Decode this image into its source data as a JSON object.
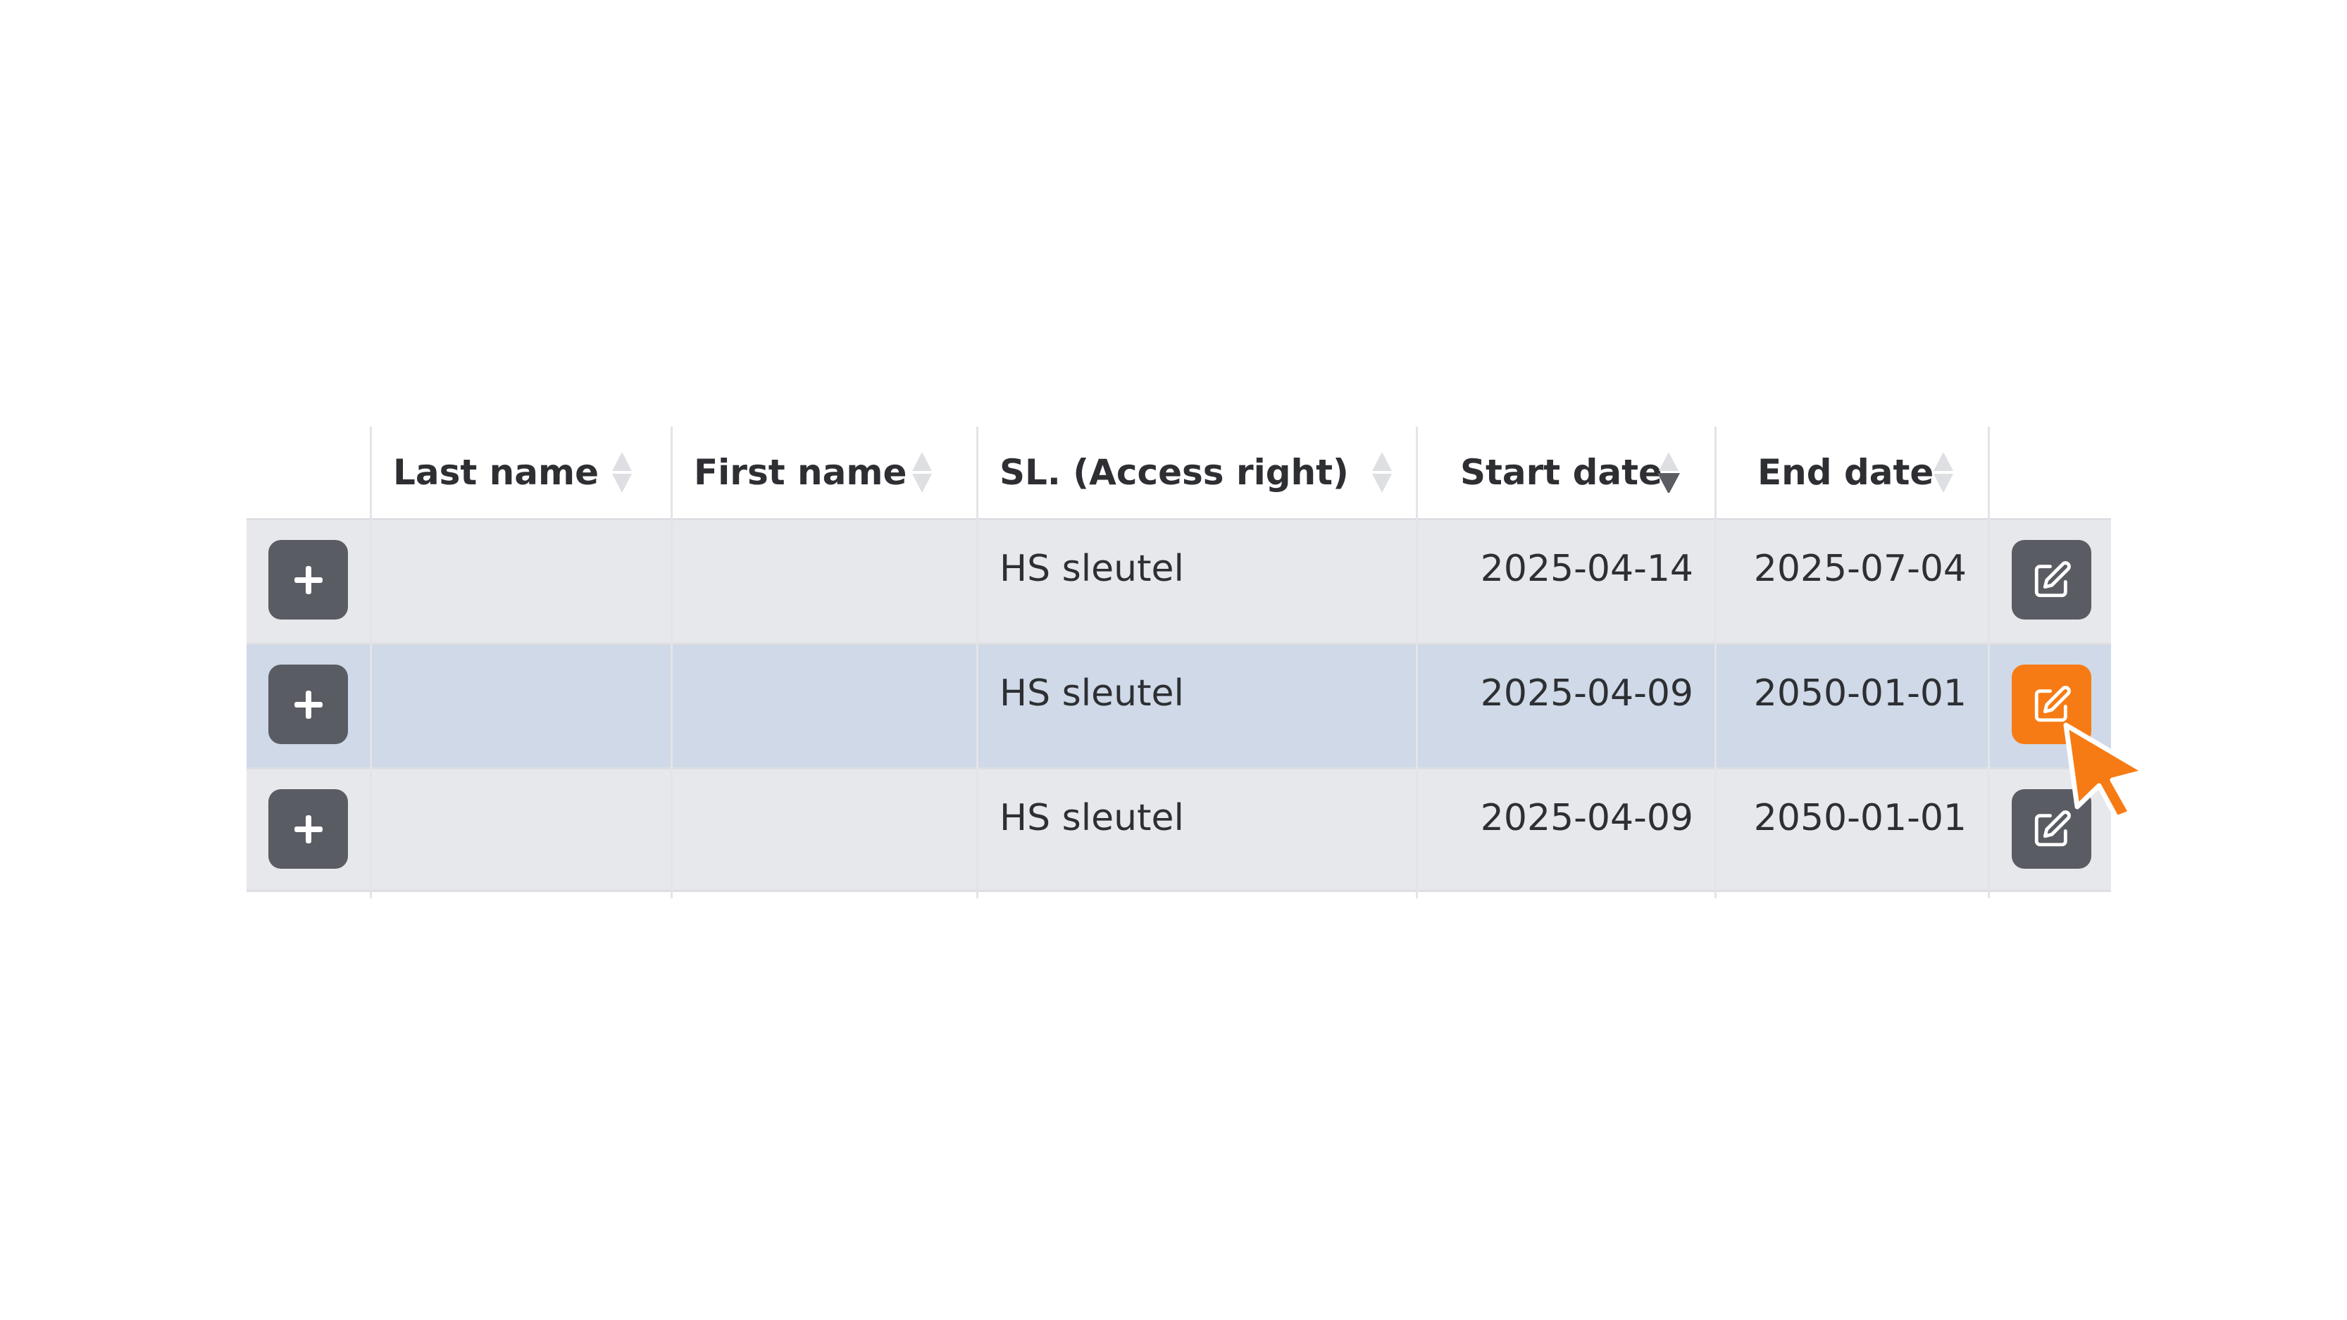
{
  "table": {
    "columns": [
      {
        "key": "actions_left",
        "label": ""
      },
      {
        "key": "last_name",
        "label": "Last name",
        "sort": "none"
      },
      {
        "key": "first_name",
        "label": "First name",
        "sort": "none"
      },
      {
        "key": "access_right",
        "label": "SL. (Access right)",
        "sort": "none"
      },
      {
        "key": "start_date",
        "label": "Start date",
        "sort": "descending"
      },
      {
        "key": "end_date",
        "label": "End date",
        "sort": "none"
      },
      {
        "key": "actions_right",
        "label": ""
      }
    ],
    "rows": [
      {
        "last_name": "",
        "first_name": "",
        "access_right": "HS sleutel",
        "start_date": "2025-04-14",
        "end_date": "2025-07-04",
        "selected": false
      },
      {
        "last_name": "",
        "first_name": "",
        "access_right": "HS sleutel",
        "start_date": "2025-04-09",
        "end_date": "2050-01-01",
        "selected": true
      },
      {
        "last_name": "",
        "first_name": "",
        "access_right": "HS sleutel",
        "start_date": "2025-04-09",
        "end_date": "2050-01-01",
        "selected": false
      }
    ]
  },
  "icons": {
    "expand": "plus-icon",
    "edit": "edit-icon",
    "sort": "sort-icon",
    "cursor": "mouse-pointer-icon"
  },
  "colors": {
    "row_bg": "#e7e8eb",
    "selected_row_bg": "#cfd9e7",
    "button_bg": "#5a5c64",
    "active_button_bg": "#f77b14",
    "cursor": "#f77b14"
  }
}
